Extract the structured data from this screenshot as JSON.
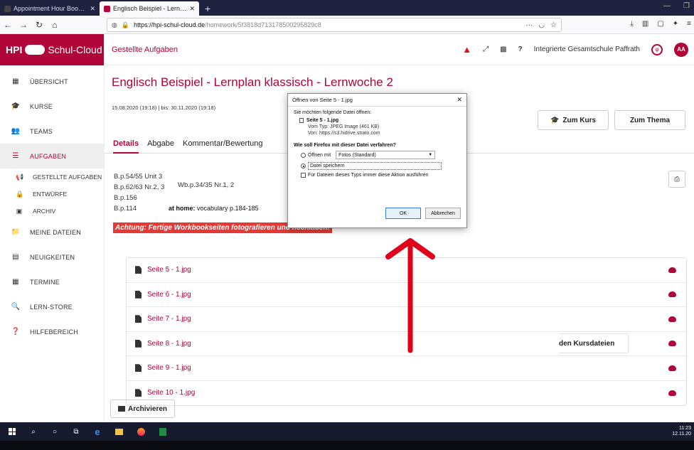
{
  "browser": {
    "tabs": [
      {
        "title": "Appointment Hour Booking Optio",
        "active": false
      },
      {
        "title": "Englisch Beispiel - Lernplan kla",
        "active": true
      }
    ],
    "url_host": "https://hpi-schul-cloud.de",
    "url_path": "/homework/5f3818d713178500295829c8"
  },
  "brand": {
    "prefix": "HPI",
    "name": "Schul-Cloud"
  },
  "sidebar": {
    "items": [
      {
        "label": "ÜBERSICHT",
        "icon": "grid-icon"
      },
      {
        "label": "KURSE",
        "icon": "graduation-cap-icon"
      },
      {
        "label": "TEAMS",
        "icon": "people-icon"
      },
      {
        "label": "AUFGABEN",
        "icon": "tasks-icon",
        "active": true
      }
    ],
    "subitems": [
      {
        "label": "GESTELLTE AUFGABEN",
        "icon": "bullhorn-icon"
      },
      {
        "label": "ENTWÜRFE",
        "icon": "lock-icon"
      },
      {
        "label": "ARCHIV",
        "icon": "archive-icon"
      }
    ],
    "items2": [
      {
        "label": "MEINE DATEIEN",
        "icon": "folder-icon"
      },
      {
        "label": "NEUIGKEITEN",
        "icon": "news-icon"
      },
      {
        "label": "TERMINE",
        "icon": "calendar-icon"
      },
      {
        "label": "LERN-STORE",
        "icon": "search-icon"
      },
      {
        "label": "HILFEBEREICH",
        "icon": "help-icon"
      }
    ]
  },
  "header": {
    "breadcrumb": "Gestellte Aufgaben",
    "school": "Integrierte Gesamtschule Paffrath",
    "avatar": "AA"
  },
  "task": {
    "title": "Englisch Beispiel - Lernplan klassisch - Lernwoche 2",
    "dates": "15.08.2020 (19:18) | bis: 30.11.2020 (19:18)",
    "btn_files": "den Kursdateien",
    "btn_course": "Zum Kurs",
    "btn_topic": "Zum Thema"
  },
  "tabs": [
    "Details",
    "Abgabe",
    "Kommentar/Bewertung"
  ],
  "description": {
    "line1": "B.p.54/55 Unit 3",
    "line2": "B.p.62/63 Nr.2, 3",
    "extra": "Wb.p.34/35 Nr.1, 2",
    "line3": "B.p.156",
    "line4": "B.p.114",
    "homework_label": "at home:",
    "homework_text": "vocabulary p.184-185",
    "alert": "Achtung: Fertige Workbookseiten fotografieren und hochladen!"
  },
  "files": [
    "Seite 5 - 1.jpg",
    "Seite 6 - 1.jpg",
    "Seite 7 - 1.jpg",
    "Seite 8 - 1.jpg",
    "Seite 9 - 1.jpg",
    "Seite 10 - 1.jpg"
  ],
  "archive_button": "Archivieren",
  "dialog": {
    "title": "Öffnen von Seite 5 - 1.jpg",
    "intro": "Sie möchten folgende Datei öffnen:",
    "filename": "Seite 5 - 1.jpg",
    "type": "Vom Typ: JPEG Image (461 KB)",
    "source": "Von: https://s3.hidrive.strato.com",
    "question": "Wie soll Firefox mit dieser Datei verfahren?",
    "open_with_label": "Öffnen mit",
    "open_with_app": "Fotos (Standard)",
    "save_label": "Datei speichern",
    "always_label": "Für Dateien dieses Typs immer diese Aktion ausführen",
    "ok": "OK",
    "cancel": "Abbrechen"
  },
  "taskbar": {
    "time": "11:23",
    "date": "12.11.20"
  },
  "colors": {
    "brand": "#b10438",
    "arrow": "#e0001a",
    "alert": "#e53935"
  }
}
